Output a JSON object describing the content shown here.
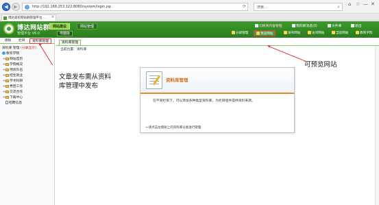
{
  "browser": {
    "url": "http://192.168.253.122:8080/system/login.jsp",
    "search_placeholder": "搜索...",
    "tab_title": "博达高校网站群管理平台 ...",
    "controls": {
      "minimize": "—",
      "maximize": "□",
      "close": "✕"
    }
  },
  "header": {
    "brand": "博达网站群",
    "subtitle": "管理平台 V6.0",
    "module_tabs": [
      {
        "label": "网站建设",
        "active": true
      },
      {
        "label": "网站管理",
        "active": false
      }
    ],
    "sub_label": "电脑版",
    "top_links": [
      {
        "label": "切换到内容管理",
        "red": true
      },
      {
        "label": "我的新消息(0)"
      },
      {
        "label": "文件库"
      },
      {
        "label": "退出"
      }
    ],
    "toolbar": [
      {
        "label": "分屏管理"
      },
      {
        "label": "预览网站",
        "highlight": true
      },
      {
        "label": "发布网站"
      },
      {
        "label": "访问网站"
      },
      {
        "label": "当前网站"
      },
      {
        "label": "教育学院"
      }
    ]
  },
  "sidebar": {
    "tabs": [
      {
        "label": "模板"
      },
      {
        "label": "栏目"
      },
      {
        "label": "资料库管理",
        "active": true
      }
    ],
    "title": "资料库 管理",
    "title_note": "(分屏显示)",
    "tree": [
      {
        "label": "教育学院",
        "icon": "globe",
        "level": 0
      },
      {
        "label": "网站首页",
        "icon": "folder",
        "level": 1
      },
      {
        "label": "学院概况",
        "icon": "folder",
        "level": 1
      },
      {
        "label": "师资队伍",
        "icon": "folder",
        "level": 1
      },
      {
        "label": "招生就业",
        "icon": "folder",
        "level": 1
      },
      {
        "label": "学术科研",
        "icon": "folder",
        "level": 1
      },
      {
        "label": "党团工作",
        "icon": "folder",
        "level": 1
      },
      {
        "label": "交流合作",
        "icon": "folder",
        "level": 1
      },
      {
        "label": "下载中心",
        "icon": "folder",
        "level": 1
      },
      {
        "label": "招聘信息",
        "icon": "doc",
        "level": 1
      }
    ]
  },
  "main": {
    "tab": "资料库管理",
    "breadcrumb": "当前位置：资料库",
    "panel": {
      "title": "资料库管理",
      "desc": "在不同栏目下，可以添加多种类型资料库，为栏目组件提供资料来源。",
      "hint": "←请点击左侧树上的资料库分类进行管理"
    }
  },
  "annotations": {
    "left": "文章发布需从资料库管理中发布",
    "right": "可预览网站"
  }
}
